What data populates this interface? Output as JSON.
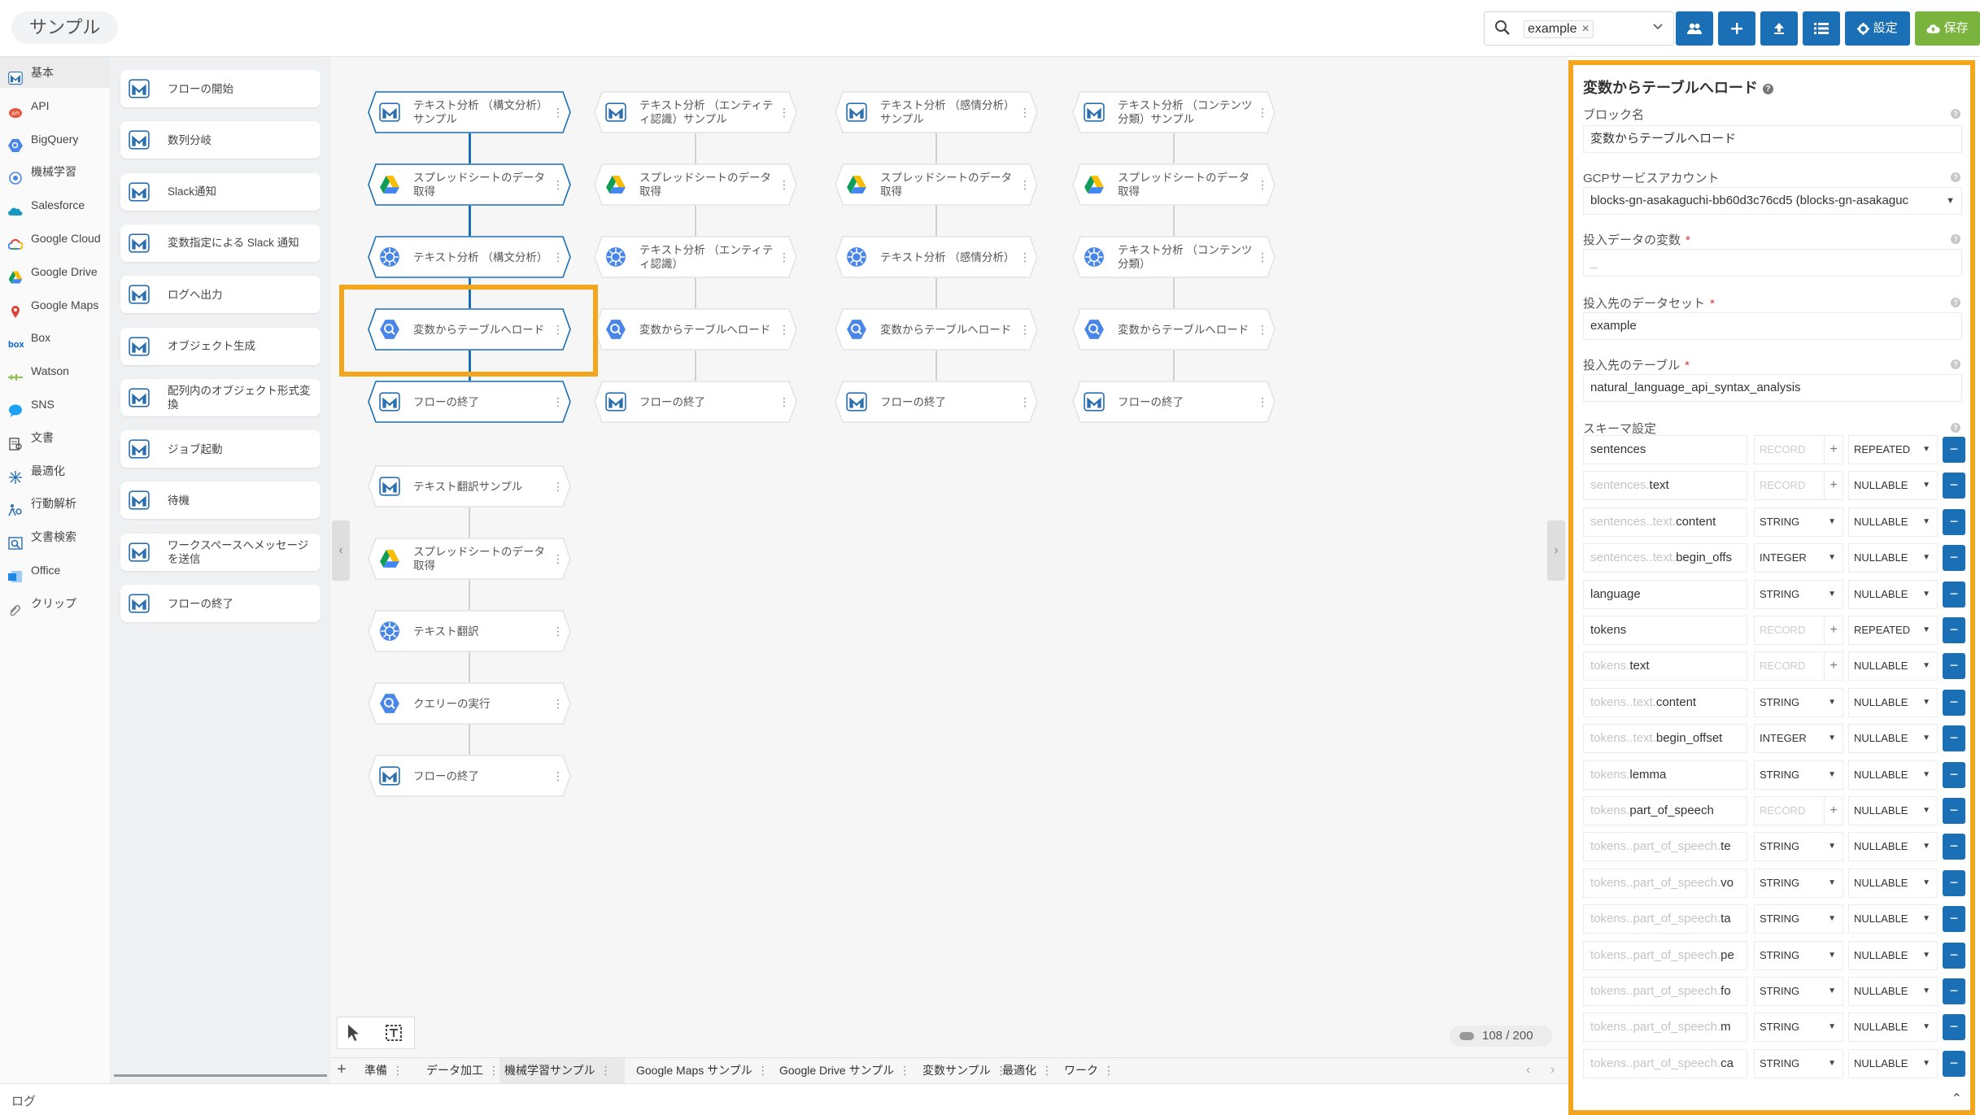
{
  "app": {
    "title": "サンプル"
  },
  "search": {
    "chip": "example"
  },
  "toolbar": {
    "settings_label": "設定",
    "save_label": "保存"
  },
  "categories": [
    {
      "label": "基本",
      "icon": "flow-basic-icon",
      "color": "#2a6fb0"
    },
    {
      "label": "API",
      "icon": "api-icon",
      "color": "#e8553e"
    },
    {
      "label": "BigQuery",
      "icon": "bigquery-icon",
      "color": "#4a86e8"
    },
    {
      "label": "機械学習",
      "icon": "brain-icon",
      "color": "#4a86e8"
    },
    {
      "label": "Salesforce",
      "icon": "salesforce-cloud-icon",
      "color": "#1798c1"
    },
    {
      "label": "Google Cloud",
      "icon": "google-cloud-icon",
      "color": "#4285f4"
    },
    {
      "label": "Google Drive",
      "icon": "google-drive-icon",
      "color": "#0f9d58"
    },
    {
      "label": "Google Maps",
      "icon": "map-pin-icon",
      "color": "#db4437"
    },
    {
      "label": "Box",
      "icon": "box-icon",
      "color": "#0061d5"
    },
    {
      "label": "Watson",
      "icon": "watson-icon",
      "color": "#8bc34a"
    },
    {
      "label": "SNS",
      "icon": "sns-bubble-icon",
      "color": "#1da1f2"
    },
    {
      "label": "文書",
      "icon": "document-icon",
      "color": "#555555"
    },
    {
      "label": "最適化",
      "icon": "optimize-icon",
      "color": "#2a6fb0"
    },
    {
      "label": "行動解析",
      "icon": "behavior-icon",
      "color": "#2a6fb0"
    },
    {
      "label": "文書検索",
      "icon": "doc-search-icon",
      "color": "#2a6fb0"
    },
    {
      "label": "Office",
      "icon": "office-icon",
      "color": "#1e88e5"
    },
    {
      "label": "クリップ",
      "icon": "clip-icon",
      "color": "#888888"
    }
  ],
  "palette": [
    {
      "label": "フローの開始"
    },
    {
      "label": "数列分岐"
    },
    {
      "label": "Slack通知"
    },
    {
      "label": "変数指定による Slack 通知"
    },
    {
      "label": "ログへ出力"
    },
    {
      "label": "オブジェクト生成"
    },
    {
      "label": "配列内のオブジェクト形式変換"
    },
    {
      "label": "ジョブ起動"
    },
    {
      "label": "待機"
    },
    {
      "label": "ワークスペースへメッセージを送信"
    },
    {
      "label": "フローの終了"
    }
  ],
  "flows": [
    {
      "nodes": [
        {
          "label": "テキスト分析 （構文分析）サンプル",
          "icon": "flow-basic"
        },
        {
          "label": "スプレッドシートのデータ取得",
          "icon": "drive"
        },
        {
          "label": "テキスト分析 （構文分析）",
          "icon": "ml"
        },
        {
          "label": "変数からテーブルへロード",
          "icon": "bq",
          "selected": true
        },
        {
          "label": "フローの終了",
          "icon": "flow-basic"
        }
      ]
    },
    {
      "nodes": [
        {
          "label": "テキスト分析 （エンティティ認識）サンプル",
          "icon": "flow-basic"
        },
        {
          "label": "スプレッドシートのデータ取得",
          "icon": "drive"
        },
        {
          "label": "テキスト分析 （エンティティ認識）",
          "icon": "ml"
        },
        {
          "label": "変数からテーブルへロード",
          "icon": "bq"
        },
        {
          "label": "フローの終了",
          "icon": "flow-basic"
        }
      ]
    },
    {
      "nodes": [
        {
          "label": "テキスト分析 （感情分析）サンプル",
          "icon": "flow-basic"
        },
        {
          "label": "スプレッドシートのデータ取得",
          "icon": "drive"
        },
        {
          "label": "テキスト分析 （感情分析）",
          "icon": "ml"
        },
        {
          "label": "変数からテーブルへロード",
          "icon": "bq"
        },
        {
          "label": "フローの終了",
          "icon": "flow-basic"
        }
      ]
    },
    {
      "nodes": [
        {
          "label": "テキスト分析 （コンテンツ分類）サンプル",
          "icon": "flow-basic"
        },
        {
          "label": "スプレッドシートのデータ取得",
          "icon": "drive"
        },
        {
          "label": "テキスト分析 （コンテンツ分類）",
          "icon": "ml"
        },
        {
          "label": "変数からテーブルへロード",
          "icon": "bq"
        },
        {
          "label": "フローの終了",
          "icon": "flow-basic"
        }
      ]
    },
    {
      "nodes": [
        {
          "label": "テキスト翻訳サンプル",
          "icon": "flow-basic"
        },
        {
          "label": "スプレッドシートのデータ取得",
          "icon": "drive"
        },
        {
          "label": "テキスト翻訳",
          "icon": "ml"
        },
        {
          "label": "クエリーの実行",
          "icon": "bq"
        },
        {
          "label": "フローの終了",
          "icon": "flow-basic"
        }
      ]
    }
  ],
  "canvas": {
    "counter": "108 / 200"
  },
  "tabs": [
    "準備",
    "データ加工",
    "機械学習サンプル",
    "Google Maps サンプル",
    "Google Drive サンプル",
    "変数サンプル",
    "最適化",
    "ワーク"
  ],
  "log": {
    "label": "ログ"
  },
  "panel": {
    "title": "変数からテーブルへロード",
    "block_name_label": "ブロック名",
    "block_name_value": "変数からテーブルへロード",
    "gcp_label": "GCPサービスアカウント",
    "gcp_value": "blocks-gn-asakaguchi-bb60d3c76cd5 (blocks-gn-asakaguc",
    "var_label": "投入データの変数",
    "var_required": "*",
    "var_placeholder": "_",
    "dataset_label": "投入先のデータセット",
    "dataset_required": "*",
    "dataset_value": "example",
    "table_label": "投入先のテーブル",
    "table_required": "*",
    "table_value": "natural_language_api_syntax_analysis",
    "schema_label": "スキーマ設定",
    "schema": [
      {
        "prefix": "",
        "name": "sentences",
        "type": "RECORD",
        "type_disabled": true,
        "plus": "+",
        "mode": "REPEATED"
      },
      {
        "prefix": "sentences.",
        "name": "text",
        "type": "RECORD",
        "type_disabled": true,
        "plus": "+",
        "mode": "NULLABLE"
      },
      {
        "prefix": "sentences..text.",
        "name": "content",
        "type": "STRING",
        "mode": "NULLABLE"
      },
      {
        "prefix": "sentences..text.",
        "name": "begin_offs",
        "type": "INTEGER",
        "mode": "NULLABLE"
      },
      {
        "prefix": "",
        "name": "language",
        "type": "STRING",
        "mode": "NULLABLE"
      },
      {
        "prefix": "",
        "name": "tokens",
        "type": "RECORD",
        "type_disabled": true,
        "plus": "+",
        "mode": "REPEATED"
      },
      {
        "prefix": "tokens.",
        "name": "text",
        "type": "RECORD",
        "type_disabled": true,
        "plus": "+",
        "mode": "NULLABLE"
      },
      {
        "prefix": "tokens..text.",
        "name": "content",
        "type": "STRING",
        "mode": "NULLABLE"
      },
      {
        "prefix": "tokens..text.",
        "name": "begin_offset",
        "type": "INTEGER",
        "mode": "NULLABLE"
      },
      {
        "prefix": "tokens.",
        "name": "lemma",
        "type": "STRING",
        "mode": "NULLABLE"
      },
      {
        "prefix": "tokens.",
        "name": "part_of_speech",
        "type": "RECORD",
        "type_disabled": true,
        "plus": "+",
        "mode": "NULLABLE"
      },
      {
        "prefix": "tokens..part_of_speech.",
        "name": "te",
        "type": "STRING",
        "mode": "NULLABLE"
      },
      {
        "prefix": "tokens..part_of_speech.",
        "name": "vo",
        "type": "STRING",
        "mode": "NULLABLE"
      },
      {
        "prefix": "tokens..part_of_speech.",
        "name": "ta",
        "type": "STRING",
        "mode": "NULLABLE"
      },
      {
        "prefix": "tokens..part_of_speech.",
        "name": "pe",
        "type": "STRING",
        "mode": "NULLABLE"
      },
      {
        "prefix": "tokens..part_of_speech.",
        "name": "fo",
        "type": "STRING",
        "mode": "NULLABLE"
      },
      {
        "prefix": "tokens..part_of_speech.",
        "name": "m",
        "type": "STRING",
        "mode": "NULLABLE"
      },
      {
        "prefix": "tokens..part_of_speech.",
        "name": "ca",
        "type": "STRING",
        "mode": "NULLABLE"
      }
    ]
  },
  "colors": {
    "accent": "#1a6fb5",
    "save": "#7bb33f",
    "highlight": "#f3a51c"
  }
}
